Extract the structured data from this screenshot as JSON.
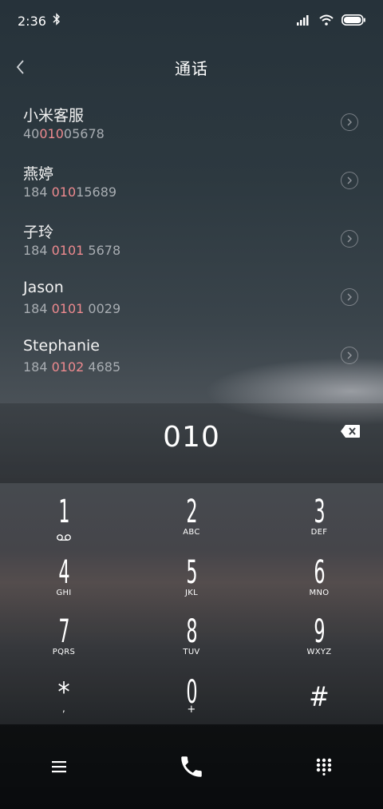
{
  "status_bar": {
    "time": "2:36",
    "bluetooth_icon": "bluetooth-icon",
    "signal_icon": "signal-icon",
    "wifi_icon": "wifi-icon",
    "battery_icon": "battery-icon"
  },
  "header": {
    "title": "通话",
    "back_icon": "chevron-left-icon"
  },
  "contacts": [
    {
      "name": "小米客服",
      "number_pre": "40",
      "number_hl": "010",
      "number_post": "05678"
    },
    {
      "name": "燕婷",
      "number_pre": "184 ",
      "number_hl": "010",
      "number_post": "15689"
    },
    {
      "name": "子玲",
      "number_pre": "184 ",
      "number_hl": "0101",
      "number_post": " 5678"
    },
    {
      "name": "Jason",
      "number_pre": "184 ",
      "number_hl": "0101",
      "number_post": " 0029"
    },
    {
      "name": "Stephanie",
      "number_pre": "184 ",
      "number_hl": "0102",
      "number_post": " 4685"
    }
  ],
  "dialer": {
    "input": "010",
    "backspace_icon": "backspace-icon"
  },
  "keypad": [
    {
      "digit": "1",
      "letters": ""
    },
    {
      "digit": "2",
      "letters": "ABC"
    },
    {
      "digit": "3",
      "letters": "DEF"
    },
    {
      "digit": "4",
      "letters": "GHI"
    },
    {
      "digit": "5",
      "letters": "JKL"
    },
    {
      "digit": "6",
      "letters": "MNO"
    },
    {
      "digit": "7",
      "letters": "PQRS"
    },
    {
      "digit": "8",
      "letters": "TUV"
    },
    {
      "digit": "9",
      "letters": "WXYZ"
    },
    {
      "digit": "*",
      "letters": ","
    },
    {
      "digit": "0",
      "letters": "+"
    },
    {
      "digit": "#",
      "letters": ""
    }
  ],
  "bottom_bar": {
    "menu_icon": "menu-icon",
    "call_icon": "phone-icon",
    "keypad_icon": "dialpad-icon"
  },
  "colors": {
    "highlight": "#ee8a8f",
    "secondary_text": "#a8adb2"
  }
}
